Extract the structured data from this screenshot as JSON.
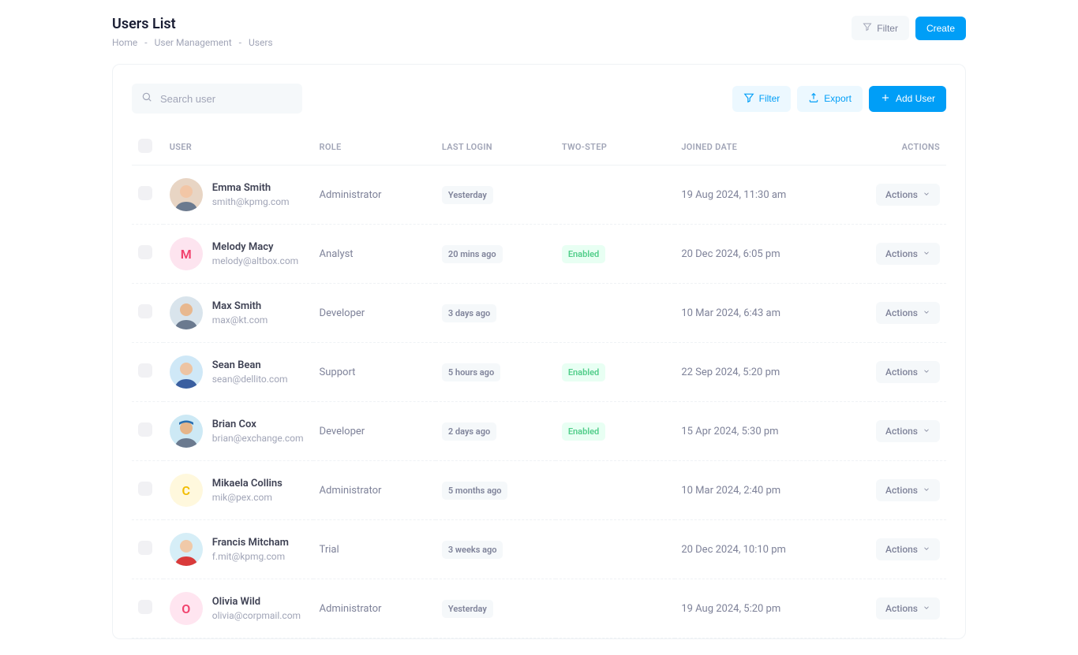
{
  "header": {
    "title": "Users List",
    "breadcrumb": [
      "Home",
      "User Management",
      "Users"
    ],
    "filter_label": "Filter",
    "create_label": "Create"
  },
  "toolbar": {
    "search_placeholder": "Search user",
    "filter_label": "Filter",
    "export_label": "Export",
    "add_user_label": "Add User"
  },
  "table": {
    "columns": {
      "user": "USER",
      "role": "ROLE",
      "last_login": "LAST LOGIN",
      "two_step": "TWO-STEP",
      "joined": "JOINED DATE",
      "actions": "ACTIONS"
    },
    "actions_label": "Actions",
    "rows": [
      {
        "name": "Emma Smith",
        "email": "smith@kpmg.com",
        "role": "Administrator",
        "last_login": "Yesterday",
        "two_step": "",
        "joined": "19 Aug 2024, 11:30 am",
        "avatar_type": "photo1"
      },
      {
        "name": "Melody Macy",
        "email": "melody@altbox.com",
        "role": "Analyst",
        "last_login": "20 mins ago",
        "two_step": "Enabled",
        "joined": "20 Dec 2024, 6:05 pm",
        "avatar_type": "letter",
        "letter": "M",
        "bg": "#fde4ef",
        "fg": "#f1416c"
      },
      {
        "name": "Max Smith",
        "email": "max@kt.com",
        "role": "Developer",
        "last_login": "3 days ago",
        "two_step": "",
        "joined": "10 Mar 2024, 6:43 am",
        "avatar_type": "photo2"
      },
      {
        "name": "Sean Bean",
        "email": "sean@dellito.com",
        "role": "Support",
        "last_login": "5 hours ago",
        "two_step": "Enabled",
        "joined": "22 Sep 2024, 5:20 pm",
        "avatar_type": "photo3"
      },
      {
        "name": "Brian Cox",
        "email": "brian@exchange.com",
        "role": "Developer",
        "last_login": "2 days ago",
        "two_step": "Enabled",
        "joined": "15 Apr 2024, 5:30 pm",
        "avatar_type": "photo4"
      },
      {
        "name": "Mikaela Collins",
        "email": "mik@pex.com",
        "role": "Administrator",
        "last_login": "5 months ago",
        "two_step": "",
        "joined": "10 Mar 2024, 2:40 pm",
        "avatar_type": "letter",
        "letter": "C",
        "bg": "#fff8dd",
        "fg": "#f1bc00"
      },
      {
        "name": "Francis Mitcham",
        "email": "f.mit@kpmg.com",
        "role": "Trial",
        "last_login": "3 weeks ago",
        "two_step": "",
        "joined": "20 Dec 2024, 10:10 pm",
        "avatar_type": "photo5"
      },
      {
        "name": "Olivia Wild",
        "email": "olivia@corpmail.com",
        "role": "Administrator",
        "last_login": "Yesterday",
        "two_step": "",
        "joined": "19 Aug 2024, 5:20 pm",
        "avatar_type": "letter",
        "letter": "O",
        "bg": "#ffe5f0",
        "fg": "#f1416c"
      }
    ]
  }
}
